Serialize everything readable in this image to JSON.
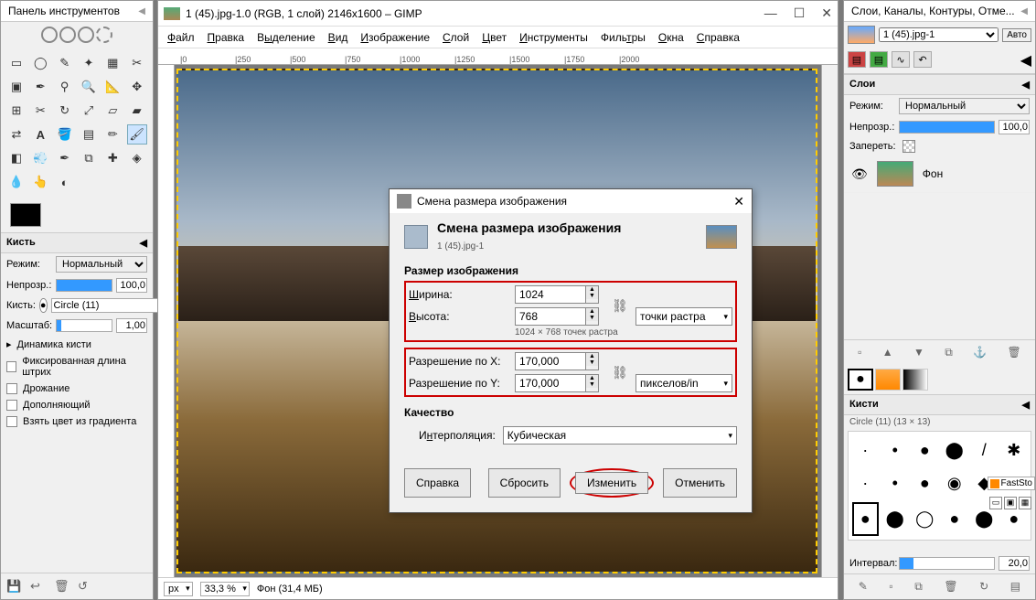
{
  "left_panel": {
    "title": "Панель инструментов",
    "brush_section": "Кисть",
    "mode_label": "Режим:",
    "mode_value": "Нормальный",
    "opacity_label": "Непрозр.:",
    "opacity_value": "100,0",
    "brush_label": "Кисть:",
    "brush_value": "Circle (11)",
    "scale_label": "Масштаб:",
    "scale_value": "1,00",
    "dynamics": "Динамика кисти",
    "fixed_length": "Фиксированная длина штрих",
    "jitter": "Дрожание",
    "incremental": "Дополняющий",
    "gradient_color": "Взять цвет из градиента"
  },
  "main": {
    "title": "1 (45).jpg-1.0 (RGB, 1 слой) 2146x1600 – GIMP",
    "menu": [
      "Файл",
      "Правка",
      "Выделение",
      "Вид",
      "Изображение",
      "Слой",
      "Цвет",
      "Инструменты",
      "Фильтры",
      "Окна",
      "Справка"
    ],
    "ruler_marks": [
      "0",
      "250",
      "500",
      "750",
      "1000",
      "1250",
      "1500",
      "1750",
      "2000"
    ],
    "status_unit": "px",
    "status_zoom": "33,3 %",
    "status_file": "Фон (31,4 МБ)"
  },
  "dialog": {
    "window_title": "Смена размера изображения",
    "heading": "Смена размера изображения",
    "subtitle": "1 (45).jpg-1",
    "size_legend": "Размер изображения",
    "width_label": "Ширина:",
    "width_value": "1024",
    "height_label": "Высота:",
    "height_value": "768",
    "units_raster": "точки растра",
    "hint": "1024 × 768 точек растра",
    "res_x_label": "Разрешение по X:",
    "res_x_value": "170,000",
    "res_y_label": "Разрешение по Y:",
    "res_y_value": "170,000",
    "res_units": "пикселов/in",
    "quality_legend": "Качество",
    "interp_label": "Интерполяция:",
    "interp_value": "Кубическая",
    "btn_help": "Справка",
    "btn_reset": "Сбросить",
    "btn_apply": "Изменить",
    "btn_cancel": "Отменить"
  },
  "right_panel": {
    "title": "Слои, Каналы, Контуры, Отме...",
    "layer_doc": "1 (45).jpg-1",
    "auto": "Авто",
    "layers_hdr": "Слои",
    "mode_label": "Режим:",
    "mode_value": "Нормальный",
    "opacity_label": "Непрозр.:",
    "opacity_value": "100,0",
    "lock_label": "Запереть:",
    "layer_name": "Фон",
    "brushes_hdr": "Кисти",
    "brush_info": "Circle (11) (13 × 13)",
    "interval_label": "Интервал:",
    "interval_value": "20,0",
    "faststone": "FastSto"
  }
}
